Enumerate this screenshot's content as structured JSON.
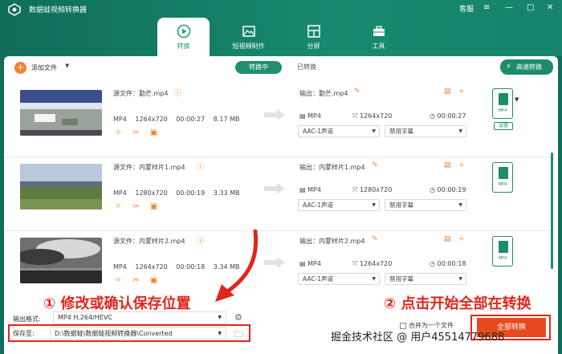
{
  "window": {
    "title": "数据蛙视频转换器",
    "service": "客服",
    "menu_icon": "menu-icon",
    "minimize": "—",
    "maximize": "□",
    "close": "✕"
  },
  "tabs": [
    {
      "label": "转换",
      "active": true,
      "icon": "convert-icon"
    },
    {
      "label": "短视频制作",
      "active": false,
      "icon": "image-icon"
    },
    {
      "label": "分屏",
      "active": false,
      "icon": "split-screen-icon"
    },
    {
      "label": "工具",
      "active": false,
      "icon": "toolbox-icon"
    }
  ],
  "toolbar": {
    "add_label": "添加文件",
    "seg_on": "转换中",
    "seg_off": "已转换",
    "fast": "高速转换"
  },
  "files": [
    {
      "source": "源文件：勤芒.mp4",
      "format": "MP4",
      "resolution": "1264x720",
      "duration": "00:00:27",
      "size": "8.17 MB",
      "output": "输出：勤芒.mp4",
      "out_format": "MP4",
      "out_resolution": "1264x720",
      "out_duration": "00:00:27",
      "audio": "AAC-1声道",
      "subtitle": "禁用字幕",
      "thumb": "racing"
    },
    {
      "source": "源文件：内蒙样片1.mp4",
      "format": "MP4",
      "resolution": "1280x720",
      "duration": "00:00:19",
      "size": "3.33 MB",
      "output": "输出：内蒙样片1.mp4",
      "out_format": "MP4",
      "out_resolution": "1280x720",
      "out_duration": "00:00:19",
      "audio": "AAC-1声道",
      "subtitle": "禁用字幕",
      "thumb": "grassland"
    },
    {
      "source": "源文件：内蒙样片2.mp4",
      "format": "MP4",
      "resolution": "1264x720",
      "duration": "00:00:18",
      "size": "3.34 MB",
      "output": "输出：内蒙样片2.mp4",
      "out_format": "MP4",
      "out_resolution": "1264x720",
      "out_duration": "00:00:18",
      "audio": "AAC-1声道",
      "subtitle": "禁用字幕",
      "thumb": "clouds"
    }
  ],
  "format_box": {
    "label": "设置"
  },
  "bottom": {
    "out_label": "输出格式:",
    "out_value": "MP4 H.264/HEVC",
    "save_label": "保存至:",
    "save_path": "D:\\数据蛙\\数据蛙视频转换器\\Converted",
    "merge": "合并为一个文件",
    "start": "全部转换"
  },
  "annotations": {
    "left": "① 修改或确认保存位置",
    "right": "② 点击开始全部在转换"
  },
  "watermark": "掘金技术社区 @ 用户4551477968​8",
  "colors": {
    "brand": "#1d8c6b",
    "accent": "#f6802b",
    "highlight": "#e1261c"
  }
}
